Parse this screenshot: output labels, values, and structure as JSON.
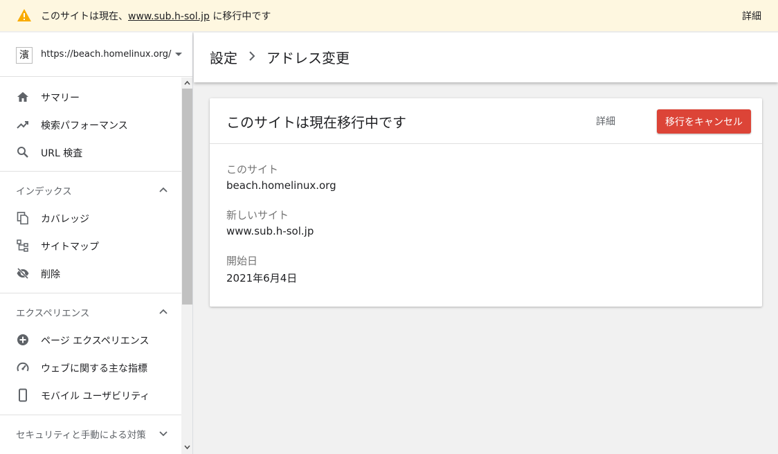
{
  "banner": {
    "message_prefix": "このサイトは現在、",
    "link": "www.sub.h-sol.jp",
    "message_suffix": " に移行中です",
    "detail": "詳細",
    "icon": "warning-icon"
  },
  "property": {
    "favicon_char": "濱",
    "url": "https://beach.homelinux.org/"
  },
  "nav": {
    "summary": "サマリー",
    "performance": "検索パフォーマンス",
    "url_inspection": "URL 検査",
    "index_section": "インデックス",
    "coverage": "カバレッジ",
    "sitemaps": "サイトマップ",
    "removals": "削除",
    "experience_section": "エクスペリエンス",
    "page_experience": "ページ エクスペリエンス",
    "web_vitals": "ウェブに関する主な指標",
    "mobile_usability": "モバイル ユーザビリティ",
    "security_section": "セキュリティと手動による対策"
  },
  "header": {
    "crumb_settings": "設定",
    "crumb_current": "アドレス変更"
  },
  "card": {
    "title": "このサイトは現在移行中です",
    "detail": "詳細",
    "cancel": "移行をキャンセル",
    "this_site_label": "このサイト",
    "this_site_value": "beach.homelinux.org",
    "new_site_label": "新しいサイト",
    "new_site_value": "www.sub.h-sol.jp",
    "start_label": "開始日",
    "start_value": "2021年6月4日"
  },
  "colors": {
    "accent_red": "#dc4437",
    "banner_bg": "#fef7e0",
    "warning": "#f9ab00"
  }
}
